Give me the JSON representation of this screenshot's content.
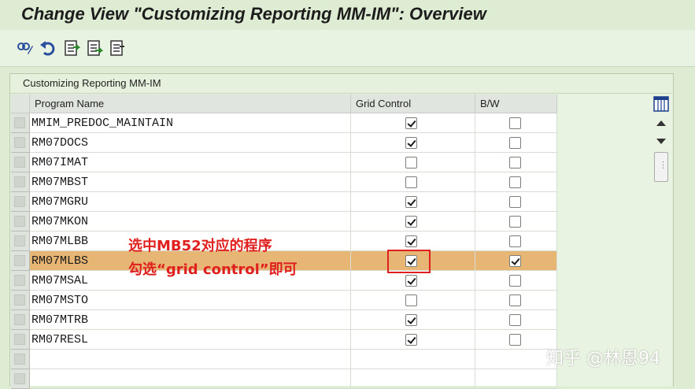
{
  "window": {
    "title": "Change View \"Customizing Reporting MM-IM\": Overview"
  },
  "toolbar": {
    "buttons": [
      {
        "icon": "display-change-icon"
      },
      {
        "icon": "undo-icon"
      },
      {
        "icon": "select-all-icon"
      },
      {
        "icon": "select-block-icon"
      },
      {
        "icon": "deselect-all-icon"
      }
    ]
  },
  "panel": {
    "title": "Customizing Reporting MM-IM"
  },
  "table": {
    "columns": [
      "Program Name",
      "Grid Control",
      "B/W"
    ],
    "rows": [
      {
        "program": "MMIM_PREDOC_MAINTAIN",
        "grid_control": true,
        "bw": false
      },
      {
        "program": "RM07DOCS",
        "grid_control": true,
        "bw": false
      },
      {
        "program": "RM07IMAT",
        "grid_control": false,
        "bw": false
      },
      {
        "program": "RM07MBST",
        "grid_control": false,
        "bw": false
      },
      {
        "program": "RM07MGRU",
        "grid_control": true,
        "bw": false
      },
      {
        "program": "RM07MKON",
        "grid_control": true,
        "bw": false
      },
      {
        "program": "RM07MLBB",
        "grid_control": true,
        "bw": false
      },
      {
        "program": "RM07MLBS",
        "grid_control": true,
        "bw": true
      },
      {
        "program": "RM07MSAL",
        "grid_control": true,
        "bw": false
      },
      {
        "program": "RM07MSTO",
        "grid_control": false,
        "bw": false
      },
      {
        "program": "RM07MTRB",
        "grid_control": true,
        "bw": false
      },
      {
        "program": "RM07RESL",
        "grid_control": true,
        "bw": false
      }
    ],
    "highlighted_row": 7
  },
  "annotation": {
    "line1": "选中MB52对应的程序",
    "line2": "勾选“grid control”即可",
    "color": "#e0201e"
  },
  "watermark": "知乎 @林恩94",
  "colors": {
    "background": "#dfecd4",
    "highlight": "#e7b574",
    "header": "#e1e5df"
  }
}
